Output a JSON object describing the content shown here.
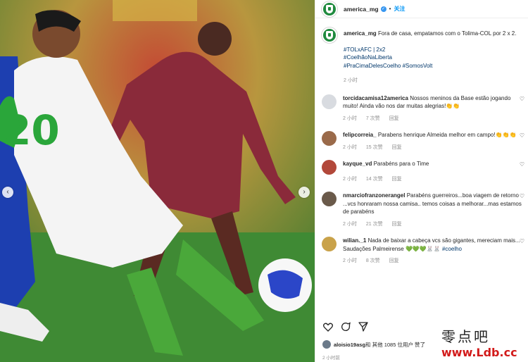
{
  "header": {
    "username": "america_mg",
    "follow": "关注",
    "dot": "•"
  },
  "post": {
    "username": "america_mg",
    "caption": "Fora de casa, empatamos com o Tolima-COL por 2 x 2.",
    "hashtags": [
      "#TOLxAFC | 2x2",
      "#CoelhãoNaLiberta",
      "#PraCimaDelesCoelho",
      "#SomosVolt"
    ],
    "time": "2 小时"
  },
  "comments": [
    {
      "user": "torcidacamisa12america",
      "text": "Nossos meninos da Base estão jogando muito! Ainda vão nos dar muitas alegrias!👏👏",
      "time": "2 小时",
      "likes": "7 次赞",
      "reply": "回复"
    },
    {
      "user": "felipcorreia_",
      "text": "Parabens henrique Almeida melhor em campo!👏👏👏",
      "time": "2 小时",
      "likes": "15 次赞",
      "reply": "回复"
    },
    {
      "user": "kayque_vd",
      "text": "Parabéns para o Time",
      "time": "2 小时",
      "likes": "14 次赞",
      "reply": "回复"
    },
    {
      "user": "nmarciofranzonerangel",
      "text": "Parabéns guerreiros...boa viagem de retorno ...vcs honraram nossa camisa.. temos coisas a melhorar...mas estamos de parabéns",
      "time": "2 小时",
      "likes": "21 次赞",
      "reply": "回复"
    },
    {
      "user": "wilian._1",
      "text": "Nada de baixar a cabeça vcs são gigantes, mereciam mais... Saudações Palmeirense 💚💚💚🐰🐰",
      "hashtag": "#coelho",
      "time": "2 小时",
      "likes": "8 次赞",
      "reply": "回复"
    }
  ],
  "likes_line": {
    "user": "aloisio19asg",
    "rest": " 和 其他 1085 位用户 赞了"
  },
  "ago": "2 小时前",
  "watermark": {
    "line1": "零点吧",
    "line2": "www.Ldb.cc"
  },
  "colors": {
    "accent": "#0095f6",
    "brand_green": "#1f8a3e",
    "hashtag": "#00376b"
  },
  "icons": [
    "chevron-left-icon",
    "chevron-right-icon",
    "verified-icon",
    "heart-icon",
    "comment-icon",
    "share-icon"
  ]
}
